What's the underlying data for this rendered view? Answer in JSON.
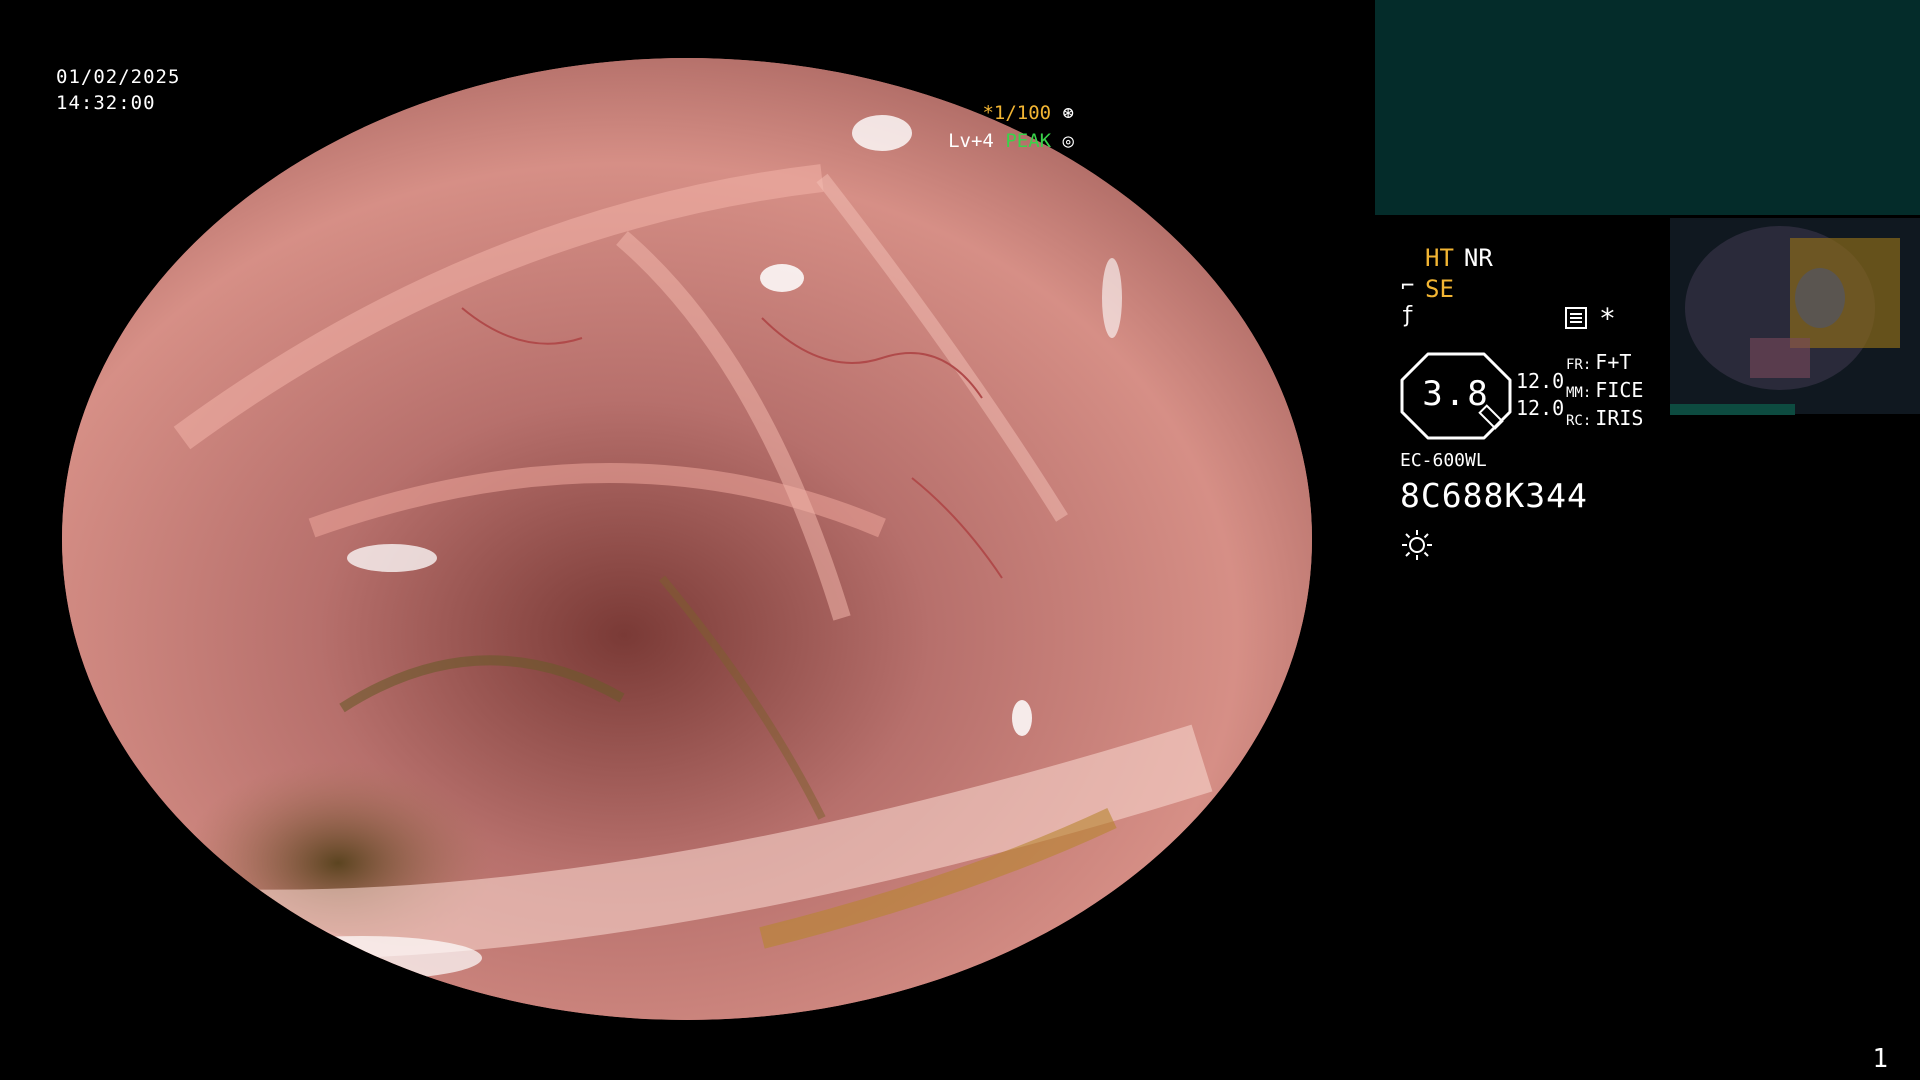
{
  "datetime": {
    "date": "01/02/2025",
    "time": "14:32:00"
  },
  "shutter": {
    "speed": "*1/100",
    "level": "Lv+4",
    "mode": "PEAK"
  },
  "processing": {
    "ht": "HT",
    "nr": "NR",
    "se": "SE"
  },
  "gauge": {
    "value": "3.8",
    "num1": "12.0",
    "num2": "12.0",
    "fr_label": "FR:",
    "fr_value": "F+T",
    "mm_label": "MM:",
    "mm_value": "FICE",
    "rc_label": "RC:",
    "rc_value": "IRIS"
  },
  "scope": {
    "model": "EC-600WL",
    "serial": "8C688K344"
  },
  "page_number": "1",
  "colors": {
    "accent_yellow": "#f2b533",
    "accent_green": "#39d34a",
    "panel_teal": "#042c2a"
  },
  "icons": [
    "shutter-icon",
    "peak-icon",
    "settings-icon",
    "star-icon",
    "flag-icon",
    "light-icon"
  ]
}
